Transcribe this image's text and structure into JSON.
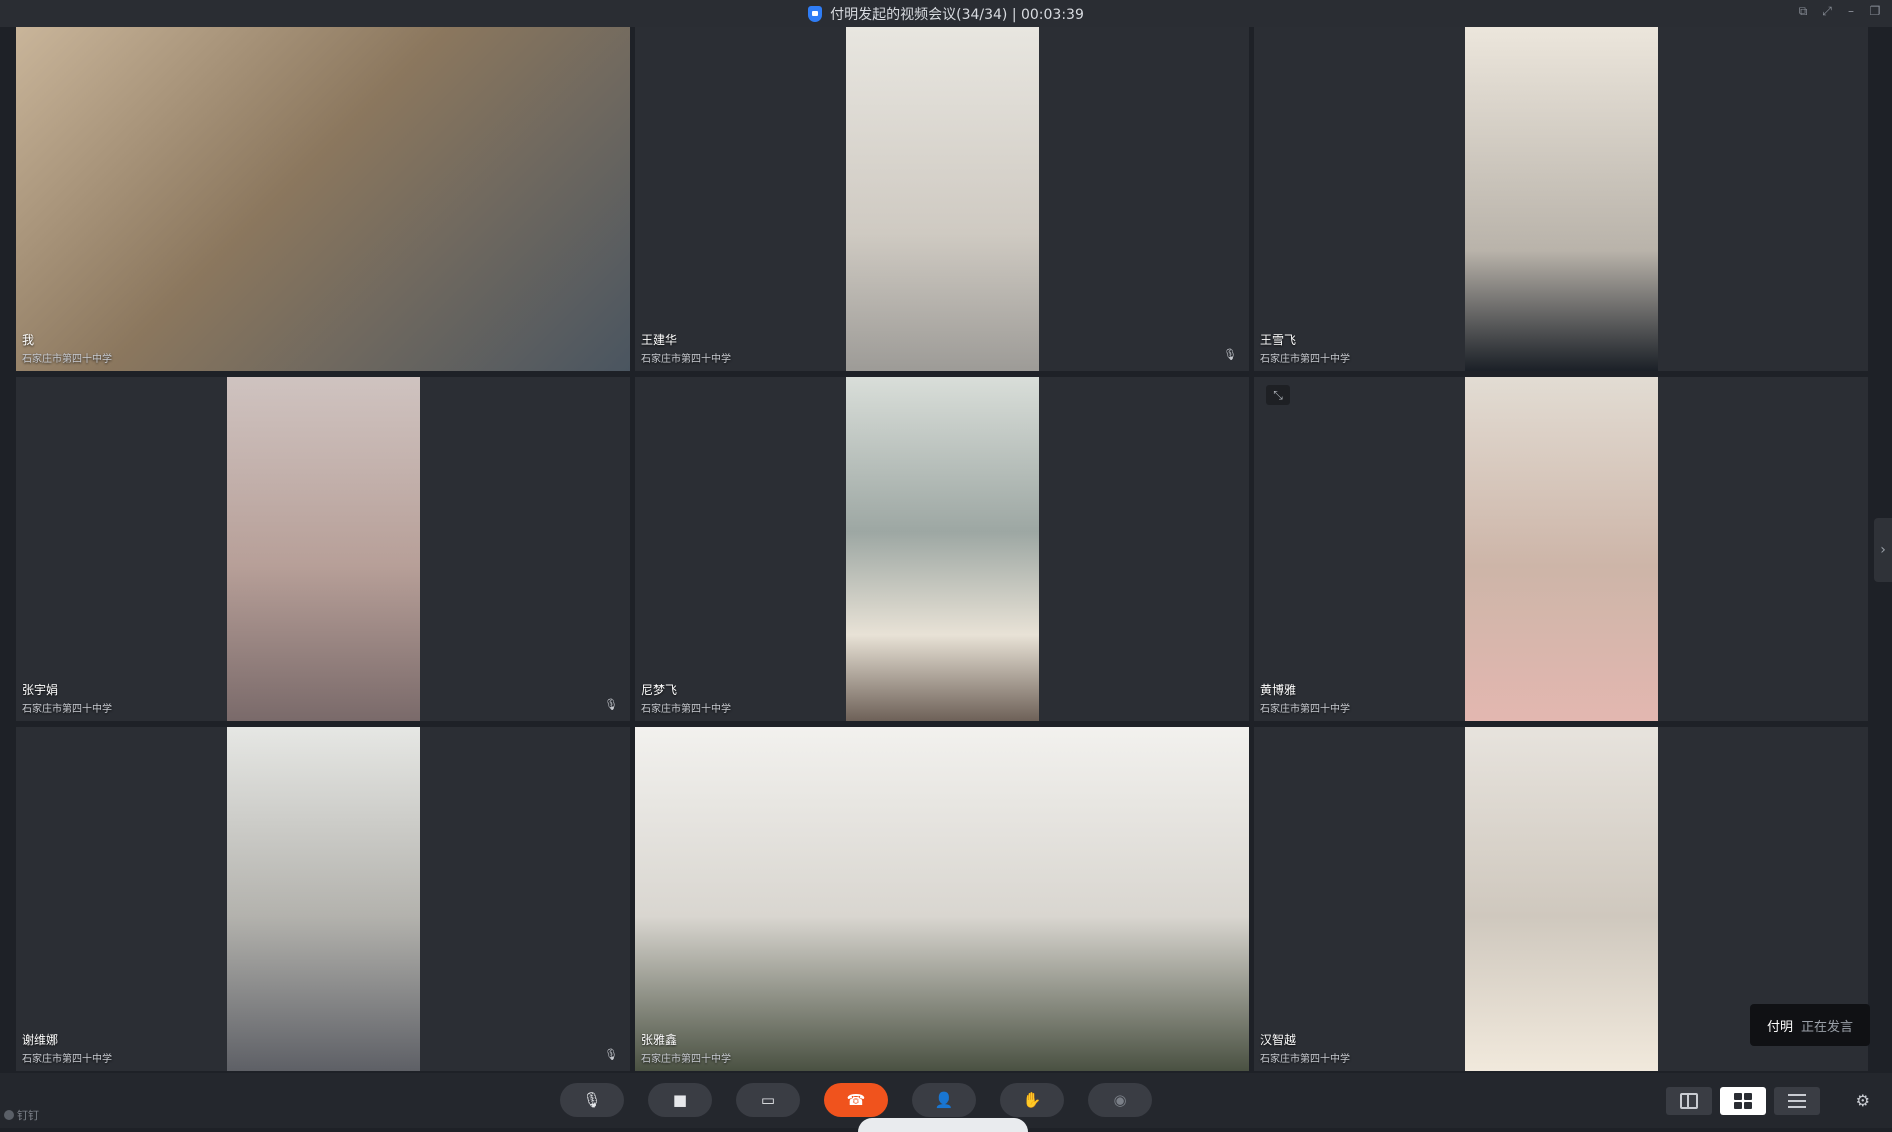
{
  "window": {
    "title": "付明发起的视频会议(34/34) | 00:03:39",
    "controls": [
      "⧉",
      "⤢",
      "–",
      "❐"
    ]
  },
  "participants": [
    {
      "name": "我",
      "org": "石家庄市第四十中学",
      "bg": "v-warm",
      "video": "full",
      "mic": ""
    },
    {
      "name": "王建华",
      "org": "石家庄市第四十中学",
      "bg": "v-light",
      "video": "center",
      "mic": "🎙"
    },
    {
      "name": "王雪飞",
      "org": "石家庄市第四十中学",
      "bg": "v-room",
      "video": "center",
      "mic": ""
    },
    {
      "name": "张宇娟",
      "org": "石家庄市第四十中学",
      "bg": "v-pink",
      "video": "center",
      "mic": "🎙"
    },
    {
      "name": "尼梦飞",
      "org": "石家庄市第四十中学",
      "bg": "v-art",
      "video": "center",
      "mic": ""
    },
    {
      "name": "黄博雅",
      "org": "石家庄市第四十中学",
      "bg": "v-beige",
      "video": "center",
      "mic": "",
      "expand": "⤡"
    },
    {
      "name": "谢维娜",
      "org": "石家庄市第四十中学",
      "bg": "v-window",
      "video": "center",
      "mic": "🎙"
    },
    {
      "name": "张雅鑫",
      "org": "石家庄市第四十中学",
      "bg": "v-wall",
      "video": "full",
      "mic": ""
    },
    {
      "name": "汉智越",
      "org": "石家庄市第四十中学",
      "bg": "v-cream",
      "video": "center",
      "mic": ""
    }
  ],
  "side_arrow": "›",
  "speaking_toast": {
    "name": "付明",
    "status": "正在发言"
  },
  "brand": "钉钉",
  "toolbar": {
    "mic_icon": "🎙",
    "camera_icon": "■",
    "share_icon": "▭",
    "hangup_icon": "☎",
    "members_icon": "👤",
    "raise_hand_icon": "✋",
    "record_icon": "◉",
    "settings_icon": "⚙"
  }
}
